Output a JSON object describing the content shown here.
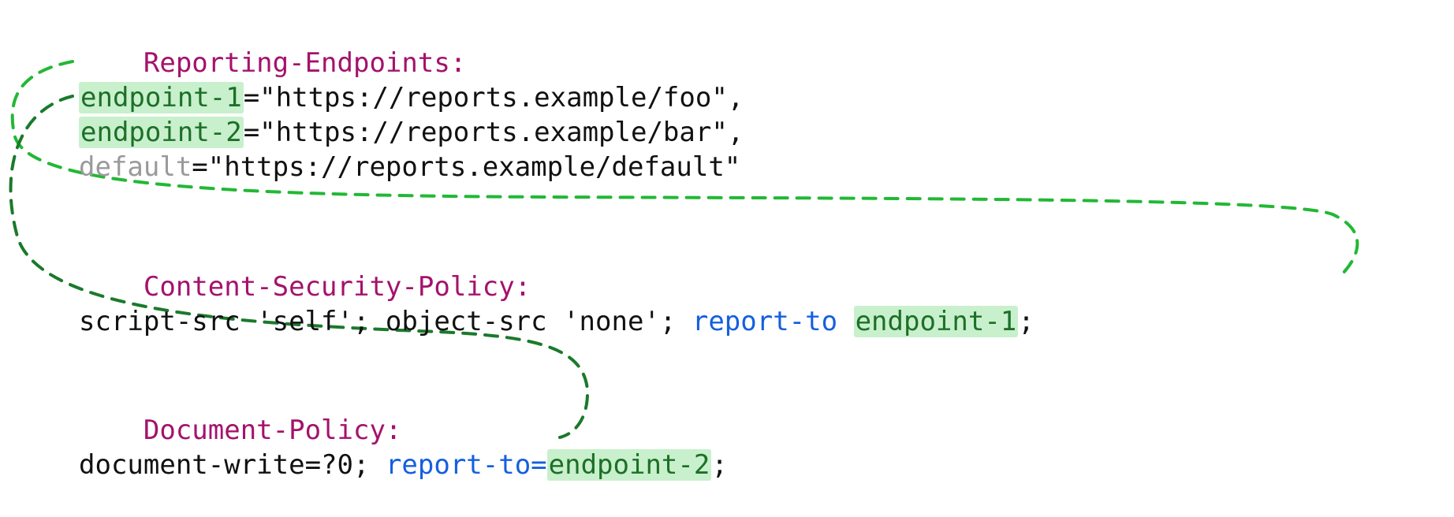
{
  "block1": {
    "header": "Reporting-Endpoints:",
    "ep1_name": "endpoint-1",
    "ep1_url": "=\"https://reports.example/foo\",",
    "ep2_name": "endpoint-2",
    "ep2_url": "=\"https://reports.example/bar\",",
    "def_name": "default",
    "def_url": "=\"https://reports.example/default\""
  },
  "block2": {
    "header": "Content-Security-Policy:",
    "directives": "script-src 'self'; object-src 'none'; ",
    "reportkw": "report-to ",
    "target": "endpoint-1",
    "tail": ";"
  },
  "block3": {
    "header": "Document-Policy:",
    "directives": "document-write=?0; ",
    "reportkw": "report-to=",
    "target": "endpoint-2",
    "tail": ";"
  },
  "arrows": {
    "color1": "#22b835",
    "color2": "#1a7a2b"
  }
}
